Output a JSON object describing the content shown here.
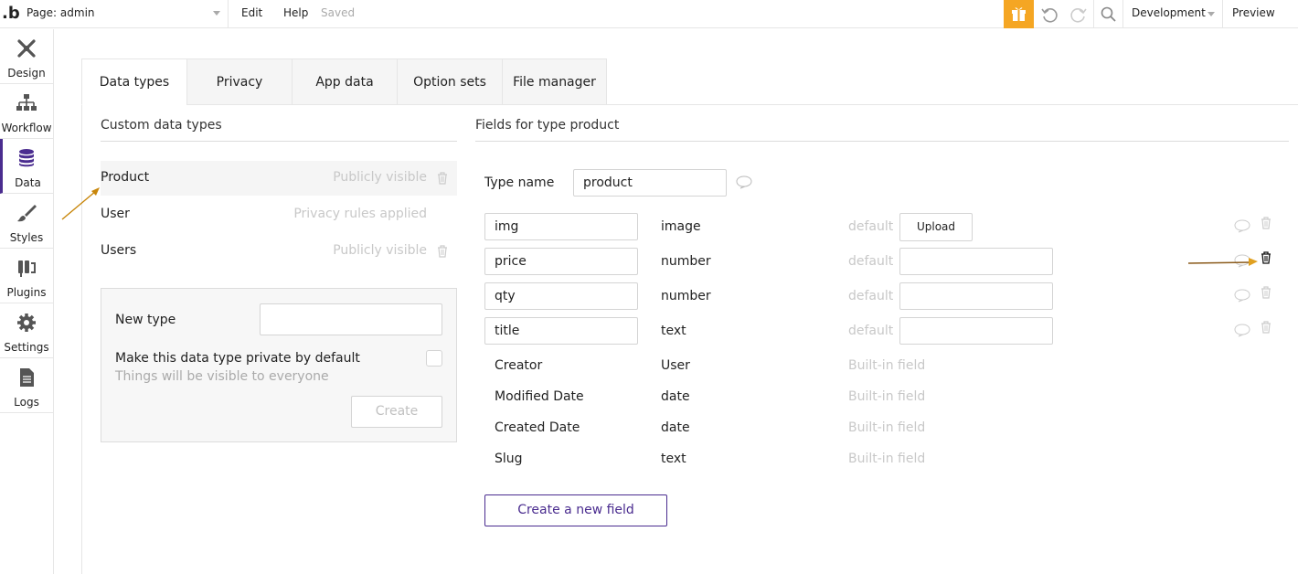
{
  "topbar": {
    "logo": ".b",
    "page_label": "Page: admin",
    "menu_edit": "Edit",
    "menu_help": "Help",
    "saved_status": "Saved",
    "environment": "Development",
    "preview": "Preview",
    "accent_color": "#f5a623"
  },
  "leftnav": {
    "items": [
      {
        "label": "Design",
        "icon": "design-icon"
      },
      {
        "label": "Workflow",
        "icon": "workflow-icon"
      },
      {
        "label": "Data",
        "icon": "database-icon",
        "active": true
      },
      {
        "label": "Styles",
        "icon": "brush-icon"
      },
      {
        "label": "Plugins",
        "icon": "plug-icon"
      },
      {
        "label": "Settings",
        "icon": "gear-icon"
      },
      {
        "label": "Logs",
        "icon": "document-icon"
      }
    ]
  },
  "tabs": [
    "Data types",
    "Privacy",
    "App data",
    "Option sets",
    "File manager"
  ],
  "custom_types": {
    "title": "Custom data types",
    "items": [
      {
        "name": "Product",
        "visibility": "Publicly visible",
        "deletable": true,
        "selected": true
      },
      {
        "name": "User",
        "visibility": "Privacy rules applied",
        "deletable": false
      },
      {
        "name": "Users",
        "visibility": "Publicly visible",
        "deletable": true
      }
    ],
    "new_type_label": "New type",
    "new_type_value": "",
    "private_label": "Make this data type private by default",
    "private_hint": "Things will be visible to everyone",
    "create_label": "Create"
  },
  "fields_panel": {
    "title": "Fields for type product",
    "type_name_label": "Type name",
    "type_name_value": "product",
    "fields": [
      {
        "name": "img",
        "type": "image",
        "default_label": "default",
        "action": "Upload"
      },
      {
        "name": "price",
        "type": "number",
        "default_label": "default"
      },
      {
        "name": "qty",
        "type": "number",
        "default_label": "default"
      },
      {
        "name": "title",
        "type": "text",
        "default_label": "default"
      }
    ],
    "builtin": [
      {
        "name": "Creator",
        "type": "User",
        "note": "Built-in field"
      },
      {
        "name": "Modified Date",
        "type": "date",
        "note": "Built-in field"
      },
      {
        "name": "Created Date",
        "type": "date",
        "note": "Built-in field"
      },
      {
        "name": "Slug",
        "type": "text",
        "note": "Built-in field"
      }
    ],
    "create_field_label": "Create a new field",
    "brand_color": "#4a2c8f"
  }
}
